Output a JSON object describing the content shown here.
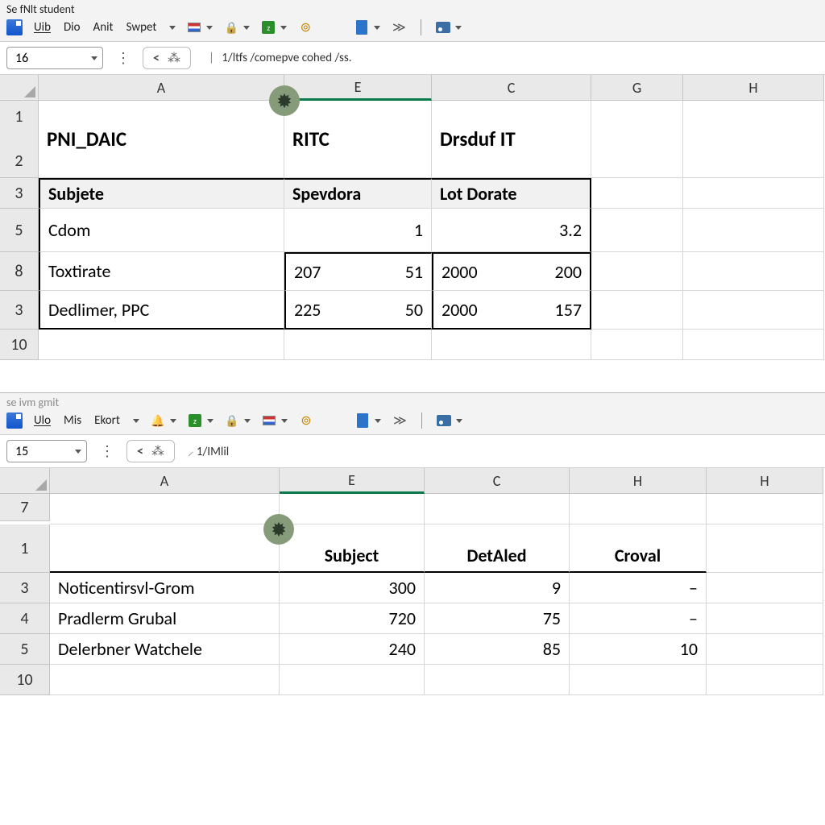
{
  "pane1": {
    "title": "Se fNlt  student",
    "menus": [
      "Uib",
      "Dio",
      "Anit",
      "Swpet"
    ],
    "namebox": "16",
    "formula": "1/ltfs /comepve cohed /ss.",
    "columns": [
      "A",
      "E",
      "C",
      "G",
      "H"
    ],
    "rows": {
      "r12": {
        "label": "1",
        "label2": "2",
        "A": "PNI_DAIC",
        "E": "RITC",
        "C": "Drsduf IT"
      },
      "r3": {
        "label": "3",
        "A": "Subjete",
        "E": "Spevdora",
        "C": "Lot Dorate"
      },
      "r5": {
        "label": "5",
        "A": "Cdom",
        "E": "1",
        "C": "3.2"
      },
      "r8": {
        "label": "8",
        "A": "Toxtirate",
        "E1": "207",
        "E2": "51",
        "C1": "2000",
        "C2": "200"
      },
      "r9": {
        "label": "3",
        "A": "Dedlimer, PPC",
        "E1": "225",
        "E2": "50",
        "C1": "2000",
        "C2": "157"
      },
      "r10": {
        "label": "10"
      }
    }
  },
  "pane2": {
    "title": "se ivm gmit",
    "menus": [
      "Ulo",
      "Mis",
      "Ekort"
    ],
    "namebox": "15",
    "formula": "1/IMlil",
    "columns": [
      "A",
      "E",
      "C",
      "H",
      "H"
    ],
    "rows": {
      "r7": {
        "label": "7"
      },
      "r1": {
        "label": "1",
        "E": "Subject",
        "C": "DetAled",
        "H": "Croval"
      },
      "r3": {
        "label": "3",
        "A": "Noticentirsvl-Grom",
        "E": "300",
        "C": "9",
        "H": "–"
      },
      "r4": {
        "label": "4",
        "A": "Pradlerm Grubal",
        "E": "720",
        "C": "75",
        "H": "–"
      },
      "r5": {
        "label": "5",
        "A": "Delerbner Watchele",
        "E": "240",
        "C": "85",
        "H": "10"
      },
      "r10": {
        "label": "10"
      }
    }
  },
  "icons": {
    "app": "app-icon",
    "flag": "flag-icon",
    "lock": "lock-icon",
    "green": "green-block-icon",
    "globe": "globe-icon",
    "blue": "blue-doc-icon",
    "share": "share-icon",
    "pic": "picture-icon",
    "bell": "bell-icon",
    "badge": "burst-badge-icon",
    "caret": "caret-down-icon",
    "lt": "less-than-icon",
    "brush": "brush-icon"
  }
}
